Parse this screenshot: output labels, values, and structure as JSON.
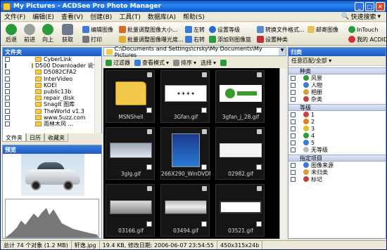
{
  "window": {
    "title": "My Pictures - ACDSee Pro Photo Manager"
  },
  "menu": [
    "文件(F)",
    "编辑(E)",
    "查看(V)",
    "创建(B)",
    "工具(T)",
    "数据库(A)",
    "帮助(S)"
  ],
  "quick_search": "快速搜索",
  "toolbar": {
    "back": "后退",
    "forward": "前进",
    "up": "向上",
    "acquire": "获取",
    "edit_image": "编辑图像",
    "print": "打印",
    "batch_resize": "批量调整图像大小...",
    "batch_exposure": "批量调整图像曝光度...",
    "rotate_left": "左转",
    "rotate_right": "右转",
    "set_rating": "设置等级",
    "add_to_basket": "添加到图像篮",
    "convert": "转换文件格式...",
    "set_category": "设置种类",
    "email": "邮寄图像",
    "intouch": "InTouch",
    "acd_me": "我的 ACDID"
  },
  "folders": {
    "title": "文件夹",
    "items": [
      "CyberLink",
      "D500 Downloader 说化",
      "D5082CFA2",
      "InterVideo",
      "KOEI",
      "public13b",
      "repair_disk",
      "SnagIt 图库",
      "TheWorld v1.3",
      "www.5uzz.com",
      "雨林木风 ..."
    ]
  },
  "left_tabs": [
    "文件夹",
    "日历",
    "收藏夹"
  ],
  "preview": {
    "title": "预览"
  },
  "address": "C:\\Documents and Settings\\crsky\\My Documents\\My Pictures",
  "view_bar": {
    "filter": "过滤器",
    "view_mode": "查看模式",
    "sort": "排序",
    "select": "选择"
  },
  "thumbnails": [
    {
      "name": "MSNShell",
      "kind": "folder"
    },
    {
      "name": "3Gfan.gif",
      "kind": "logo1"
    },
    {
      "name": "3gfan_j_28.gif",
      "kind": "logo2"
    },
    {
      "name": "3glg.gif",
      "kind": "logo3"
    },
    {
      "name": "266X290_WinDVDMC...",
      "kind": "dvd"
    },
    {
      "name": "02982.gif",
      "kind": "plain"
    },
    {
      "name": "03166.gif",
      "kind": "metal"
    },
    {
      "name": "03494.gif",
      "kind": "metal2"
    },
    {
      "name": "03521.gif",
      "kind": "desk"
    }
  ],
  "organize": {
    "title": "归类",
    "match": "任意匹配/全部",
    "categories_header": "种类",
    "categories": [
      "风景",
      "人物",
      "相册",
      "杂类"
    ],
    "ratings_header": "等级",
    "ratings": [
      "1",
      "2",
      "3",
      "4",
      "5",
      "无等级"
    ],
    "special_header": "指定项目",
    "special": [
      "图像来源",
      "未归类",
      "标记"
    ]
  },
  "status": {
    "total": "总计 74 个对象 (1.2 MB)",
    "file": "轩逸.jpg",
    "info": "19.4 KB, 修改日期: 2006-06-07 23:54:55",
    "dims": "450x315x24b"
  },
  "colors": {
    "title_blue": "#0a5fd8",
    "grid_bg": "#000000",
    "folder_yellow": "#f2cb4c"
  }
}
